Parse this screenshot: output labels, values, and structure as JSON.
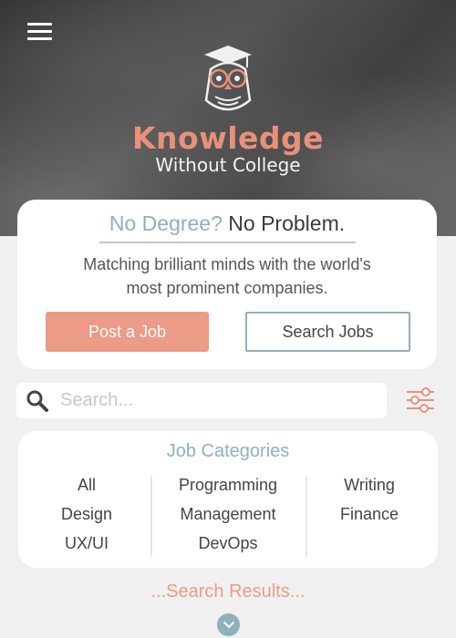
{
  "logo": {
    "word1": "Knowledge",
    "word2": "Without College"
  },
  "hero": {
    "headline_muted": "No Degree?",
    "headline_strong": "No Problem.",
    "tagline_line1": "Matching brilliant minds with the world's",
    "tagline_line2": "most prominent companies.",
    "post_button": "Post a Job",
    "search_button": "Search Jobs"
  },
  "search": {
    "placeholder": "Search...",
    "value": ""
  },
  "categories": {
    "title": "Job Categories",
    "col1": [
      "All",
      "Design",
      "UX/UI"
    ],
    "col2": [
      "Programming",
      "Management",
      "DevOps"
    ],
    "col3": [
      "Writing",
      "Finance"
    ]
  },
  "results": {
    "title": "...Search Results..."
  },
  "icons": {
    "menu": "hamburger-menu-icon",
    "logo": "owl-logo-icon",
    "search": "magnifier-icon",
    "filter": "sliders-icon",
    "expand": "chevron-down-icon"
  },
  "colors": {
    "accent_coral": "#eb9b86",
    "accent_blue": "#8fb0bd",
    "text_dark": "#3b3b3b",
    "page_bg": "#f0f0f0"
  }
}
